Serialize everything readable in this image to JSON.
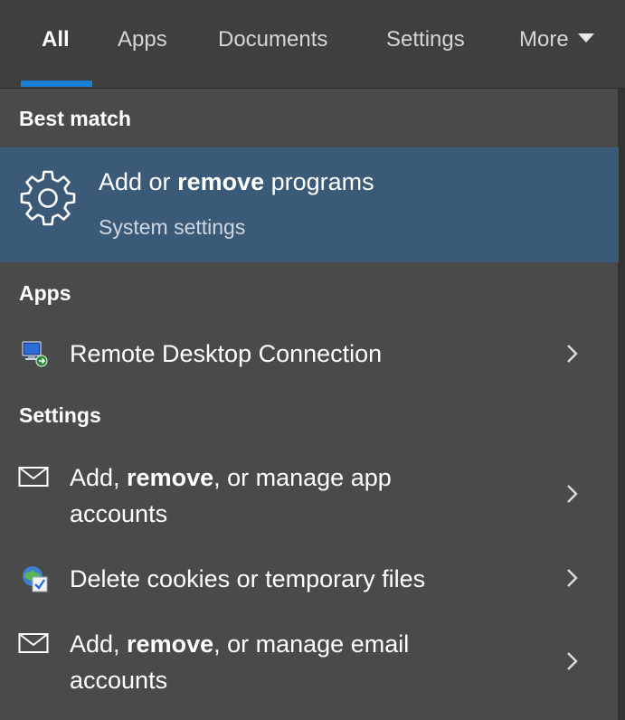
{
  "tabs": [
    {
      "label": "All",
      "active": true
    },
    {
      "label": "Apps"
    },
    {
      "label": "Documents"
    },
    {
      "label": "Settings"
    },
    {
      "label": "More"
    }
  ],
  "best_match": {
    "header": "Best match",
    "title_pre": "Add or ",
    "title_bold": "remove",
    "title_post": " programs",
    "subtitle": "System settings",
    "icon": "gear-icon"
  },
  "apps": {
    "header": "Apps",
    "items": [
      {
        "label": "Remote Desktop Connection",
        "icon": "remote-desktop-icon"
      }
    ]
  },
  "settings": {
    "header": "Settings",
    "items": [
      {
        "pre": "Add, ",
        "bold": "remove",
        "post": ", or manage app",
        "line2": "accounts",
        "icon": "envelope-icon"
      },
      {
        "label": "Delete cookies or temporary files",
        "icon": "internet-options-icon"
      },
      {
        "pre": "Add, ",
        "bold": "remove",
        "post": ", or manage email",
        "line2": "accounts",
        "icon": "envelope-icon"
      }
    ]
  },
  "colors": {
    "selected_bg": "#3a5a78",
    "accent": "#1a80d6",
    "panel_bg": "#4a4a4a"
  }
}
